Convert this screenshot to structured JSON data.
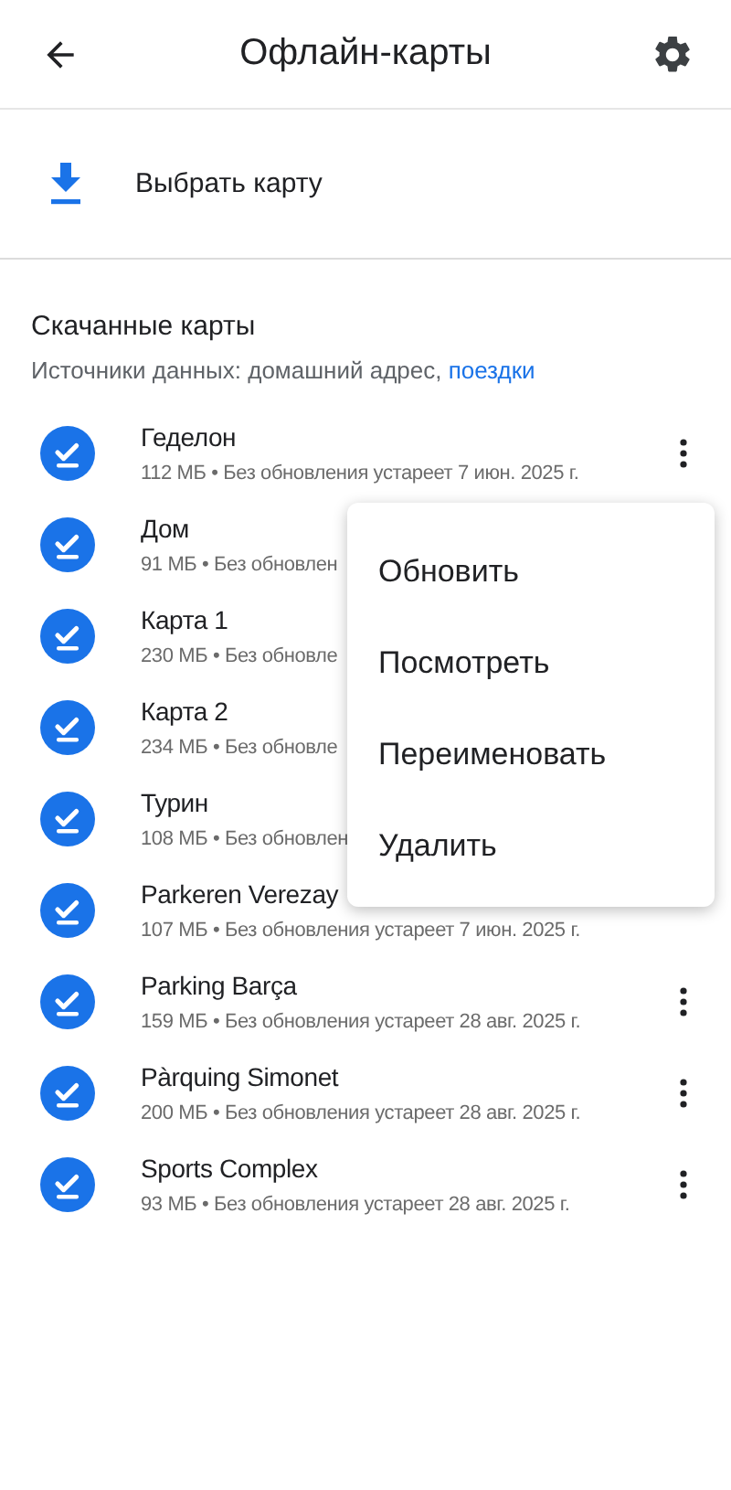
{
  "header": {
    "title": "Офлайн-карты"
  },
  "select_map": {
    "label": "Выбрать карту"
  },
  "section": {
    "title": "Скачанные карты",
    "sources": "Источники данных: домашний адрес, ",
    "sources_link": "поездки"
  },
  "maps": [
    {
      "name": "Геделон",
      "details": "112 МБ • Без обновления устареет 7 июн. 2025 г.",
      "menu_button": true,
      "menu": {
        "items": [
          "Обновить",
          "Посмотреть",
          "Переименовать",
          "Удалить"
        ]
      }
    },
    {
      "name": "Дом",
      "details": "91 МБ • Без обновлен",
      "menu_button": false
    },
    {
      "name": "Карта 1",
      "details": "230 МБ • Без обновле",
      "menu_button": false
    },
    {
      "name": "Карта 2",
      "details": "234 МБ • Без обновле",
      "menu_button": false
    },
    {
      "name": "Турин",
      "details": "108 МБ • Без обновлен",
      "menu_button": false
    },
    {
      "name": "Parkeren Verezay",
      "details": "107 МБ • Без обновления устареет 7 июн. 2025 г.",
      "menu_button": false
    },
    {
      "name": "Parking Barça",
      "details": "159 МБ • Без обновления устареет 28 авг. 2025 г.",
      "menu_button": true
    },
    {
      "name": "Pàrquing Simonet",
      "details": "200 МБ • Без обновления устареет 28 авг. 2025 г.",
      "menu_button": true
    },
    {
      "name": "Sports Complex",
      "details": "93 МБ • Без обновления устареет 28 авг. 2025 г.",
      "menu_button": true
    }
  ]
}
